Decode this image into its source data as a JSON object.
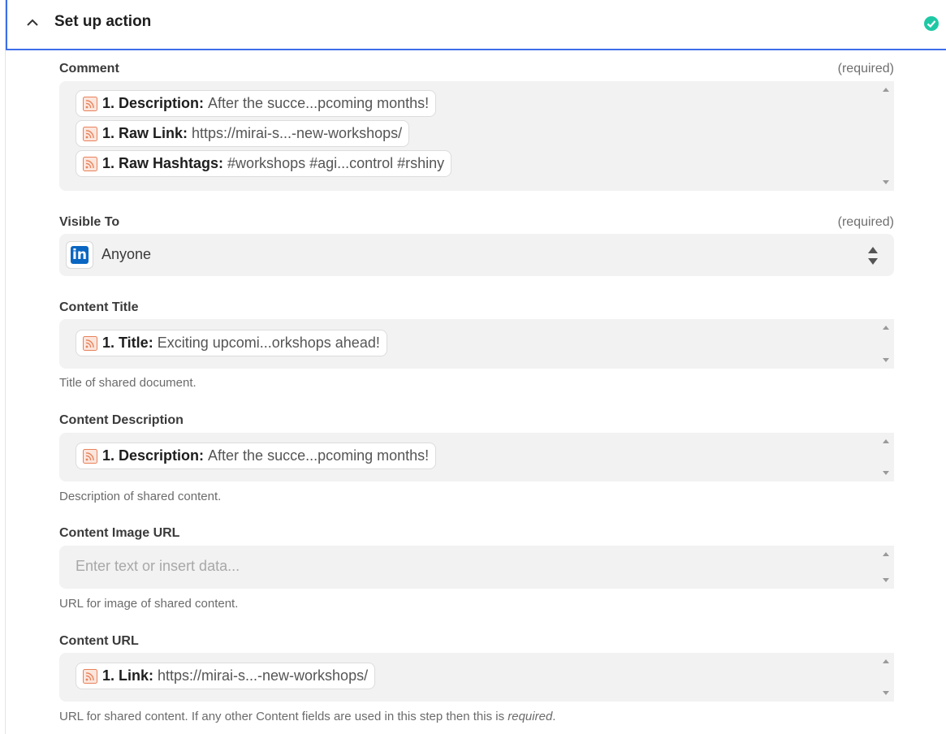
{
  "header": {
    "title": "Set up action"
  },
  "colors": {
    "accent": "#3d6ee8",
    "success": "#1fc8a5",
    "linkedin": "#0a66c2",
    "rss": "#e8815a"
  },
  "fields": {
    "comment": {
      "label": "Comment",
      "required": "(required)",
      "pills": [
        {
          "key": "1. Description:",
          "value": "After the succe...pcoming months!"
        },
        {
          "key": "1. Raw Link:",
          "value": "https://mirai-s...-new-workshops/"
        },
        {
          "key": "1. Raw Hashtags:",
          "value": "#workshops #agi...control #rshiny"
        }
      ]
    },
    "visible_to": {
      "label": "Visible To",
      "required": "(required)",
      "logo": "in",
      "value": "Anyone"
    },
    "content_title": {
      "label": "Content Title",
      "pill": {
        "key": "1. Title:",
        "value": "Exciting upcomi...orkshops ahead!"
      },
      "help": "Title of shared document."
    },
    "content_description": {
      "label": "Content Description",
      "pill": {
        "key": "1. Description:",
        "value": "After the succe...pcoming months!"
      },
      "help": "Description of shared content."
    },
    "content_image_url": {
      "label": "Content Image URL",
      "placeholder": "Enter text or insert data...",
      "help": "URL for image of shared content."
    },
    "content_url": {
      "label": "Content URL",
      "pill": {
        "key": "1. Link:",
        "value": "https://mirai-s...-new-workshops/"
      },
      "help_prefix": "URL for shared content. If any other Content fields are used in this step then this is ",
      "help_em": "required",
      "help_suffix": "."
    }
  }
}
